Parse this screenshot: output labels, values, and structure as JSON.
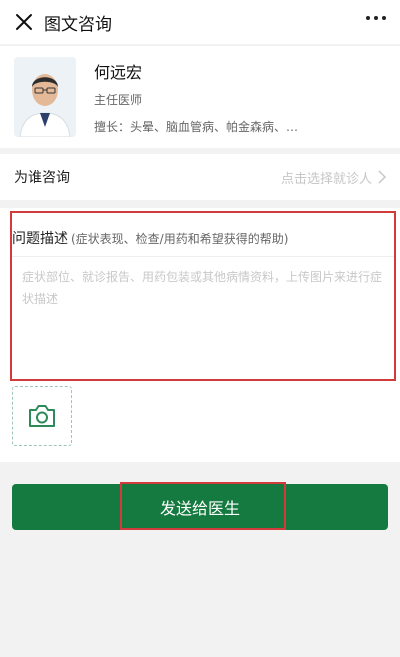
{
  "nav": {
    "title": "图文咨询",
    "close_icon": "close-icon",
    "more_icon": "more-icon"
  },
  "doctor": {
    "name": "何远宏",
    "title": "主任医师",
    "skill": "擅长：头晕、脑血管病、帕金森病、…"
  },
  "consult_for": {
    "label": "为谁咨询",
    "placeholder": "点击选择就诊人"
  },
  "description": {
    "title": "问题描述",
    "hint": "(症状表现、检查/用药和希望获得的帮助)",
    "placeholder": "症状部位、就诊报告、用药包装或其他病情资料，上传图片来进行症状描述"
  },
  "upload": {
    "icon": "camera-icon"
  },
  "submit": {
    "label": "发送给医生"
  },
  "colors": {
    "primary": "#157a3f",
    "highlight": "#d13b3b"
  }
}
